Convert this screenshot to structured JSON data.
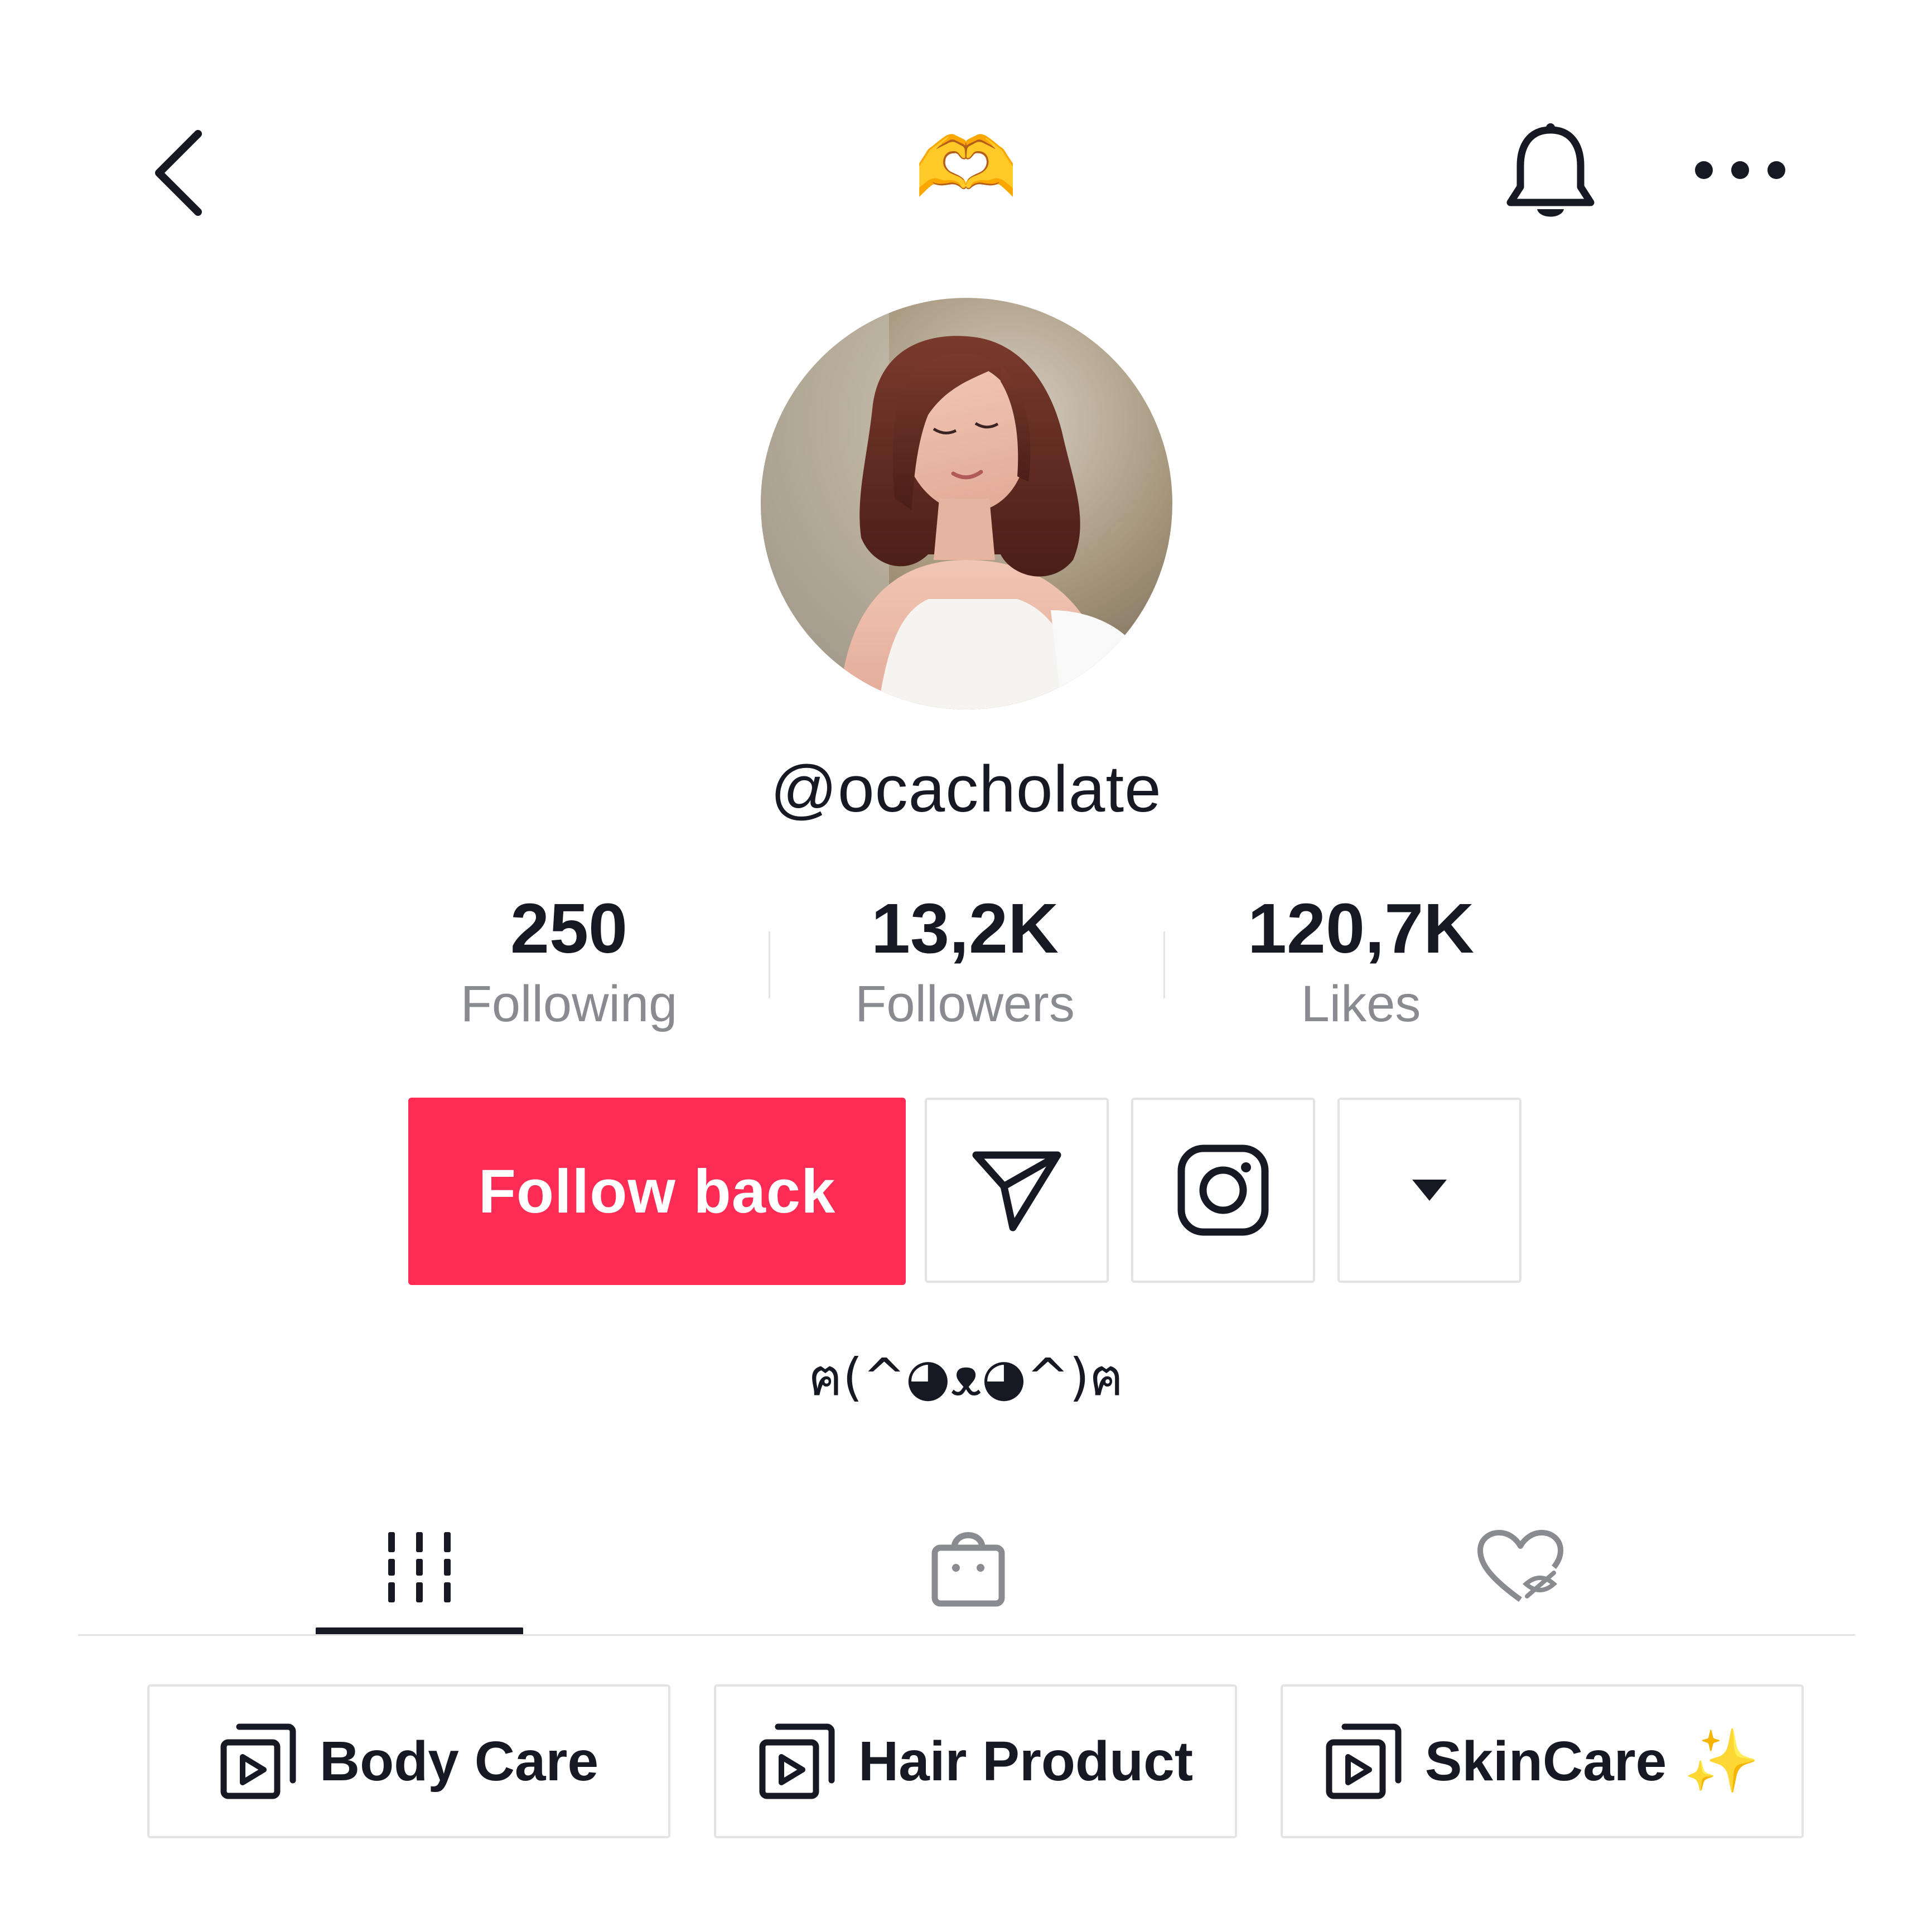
{
  "header": {
    "title_emoji": "🫶",
    "icons": [
      "back-arrow-icon",
      "bell-icon",
      "more-horizontal-icon"
    ]
  },
  "profile": {
    "avatar": "profile-photo",
    "username": "@ocacholate",
    "bio": "ฅ(^◕ᴥ◕^)ฅ"
  },
  "stats": {
    "following": {
      "value": "250",
      "label": "Following"
    },
    "followers": {
      "value": "13,2K",
      "label": "Followers"
    },
    "likes": {
      "value": "120,7K",
      "label": "Likes"
    }
  },
  "actions": {
    "follow_label": "Follow back",
    "icons": [
      "send-message-icon",
      "instagram-icon",
      "caret-down-icon"
    ]
  },
  "tabs": [
    {
      "name": "videos",
      "icon": "grid-columns-icon",
      "active": true
    },
    {
      "name": "shop",
      "icon": "shopping-bag-icon",
      "active": false
    },
    {
      "name": "liked",
      "icon": "heart-hidden-icon",
      "active": false
    }
  ],
  "playlists": [
    {
      "label": "Body Care",
      "icon": "playlist-icon"
    },
    {
      "label": "Hair Product",
      "icon": "playlist-icon"
    },
    {
      "label": "SkinCare",
      "icon": "playlist-icon",
      "emoji": "✨"
    }
  ],
  "colors": {
    "accent": "#fe2c55",
    "text": "#161823",
    "muted": "#8a8b91",
    "border": "#e3e3e4"
  }
}
